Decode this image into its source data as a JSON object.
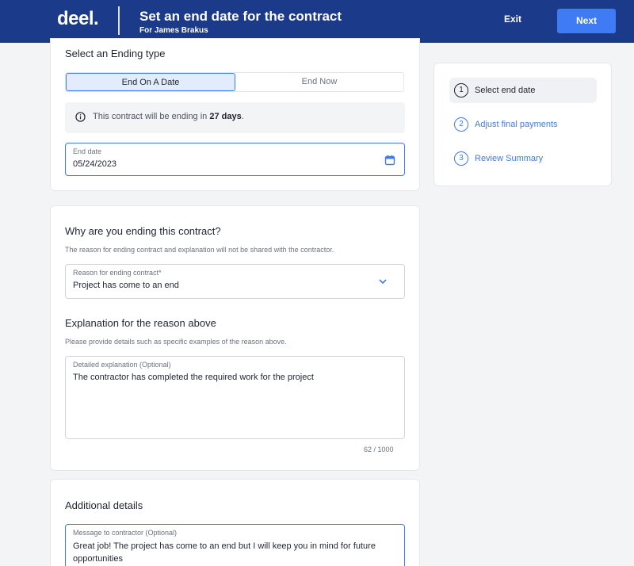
{
  "header": {
    "logo": "deel.",
    "title": "Set an end date for the contract",
    "subtitle": "For James Brakus",
    "exit_label": "Exit",
    "next_label": "Next"
  },
  "ending_type": {
    "heading": "Select an Ending type",
    "options": [
      "End On A Date",
      "End Now"
    ],
    "selected": "End On A Date",
    "notice_prefix": "This contract will be ending in ",
    "notice_days": "27 days",
    "notice_suffix": ".",
    "end_date_label": "End date",
    "end_date_value": "05/24/2023"
  },
  "reason": {
    "heading": "Why are you ending this contract?",
    "help": "The reason for ending contract and explanation will not be shared with the contractor.",
    "select_label": "Reason for ending contract*",
    "select_value": "Project has come to an end",
    "explanation_heading": "Explanation for the reason above",
    "explanation_help": "Please provide details such as specific examples of the reason above.",
    "explanation_label": "Detailed explanation (Optional)",
    "explanation_value": "The contractor has completed the required work for the project",
    "counter": "62 / 1000"
  },
  "additional": {
    "heading": "Additional details",
    "message_label": "Message to contractor (Optional)",
    "message_value": "Great job! The project has come to an end but I will keep you in mind for future opportunities"
  },
  "steps": [
    {
      "number": "1",
      "label": "Select end date",
      "state": "current"
    },
    {
      "number": "2",
      "label": "Adjust final payments",
      "state": "todo"
    },
    {
      "number": "3",
      "label": "Review Summary",
      "state": "todo"
    }
  ],
  "colors": {
    "topbar": "#1c3a8a",
    "accent": "#3e7bf5",
    "background": "#f3f4f6"
  },
  "icons": {
    "info": "info-icon",
    "calendar": "calendar-icon",
    "chevron": "chevron-down-icon"
  }
}
